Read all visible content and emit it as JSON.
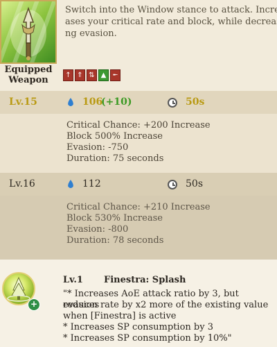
{
  "skill": {
    "icon": "spear-window-stance-icon",
    "equipped_label_1": "Equipped",
    "equipped_label_2": "Weapon",
    "description_lines": [
      "Switch into the Window stance to attack. Incre",
      "ases your critical rate and block, while decreas",
      "ng evasion."
    ],
    "weapon_icons": [
      "spear-icon",
      "twin-spear-icon",
      "double-spear-icon",
      "tree-icon",
      "gun-icon"
    ]
  },
  "levels": [
    {
      "level": "Lv.15",
      "sp_cost": "106",
      "sp_bonus": "(+10)",
      "cooldown": "50s",
      "effects": [
        "Critical Chance: +200 Increase",
        "Block 500% Increase",
        "Evasion: -750",
        "Duration: 75 seconds"
      ]
    },
    {
      "level": "Lv.16",
      "sp_cost": "112",
      "sp_bonus": "",
      "cooldown": "50s",
      "effects": [
        "Critical Chance: +210 Increase",
        "Block 530% Increase",
        "Evasion: -800",
        "Duration: 78 seconds"
      ]
    }
  ],
  "rune": {
    "icon": "finestra-splash-icon",
    "badge_icon": "plus-badge-icon",
    "level": "Lv.1",
    "name": "Finestra: Splash",
    "lines": [
      "\"* Increases AoE attack ratio by 3, but reduces",
      "evasion rate by x2 more of the existing value",
      "when [Finestra] is active",
      "* Increases SP consumption by 3",
      "* Increases SP consumption by 10%\""
    ]
  },
  "colors": {
    "level_gold": "#b99a13",
    "bonus_green": "#3d9a25",
    "sp_blue": "#2f7fd0"
  }
}
